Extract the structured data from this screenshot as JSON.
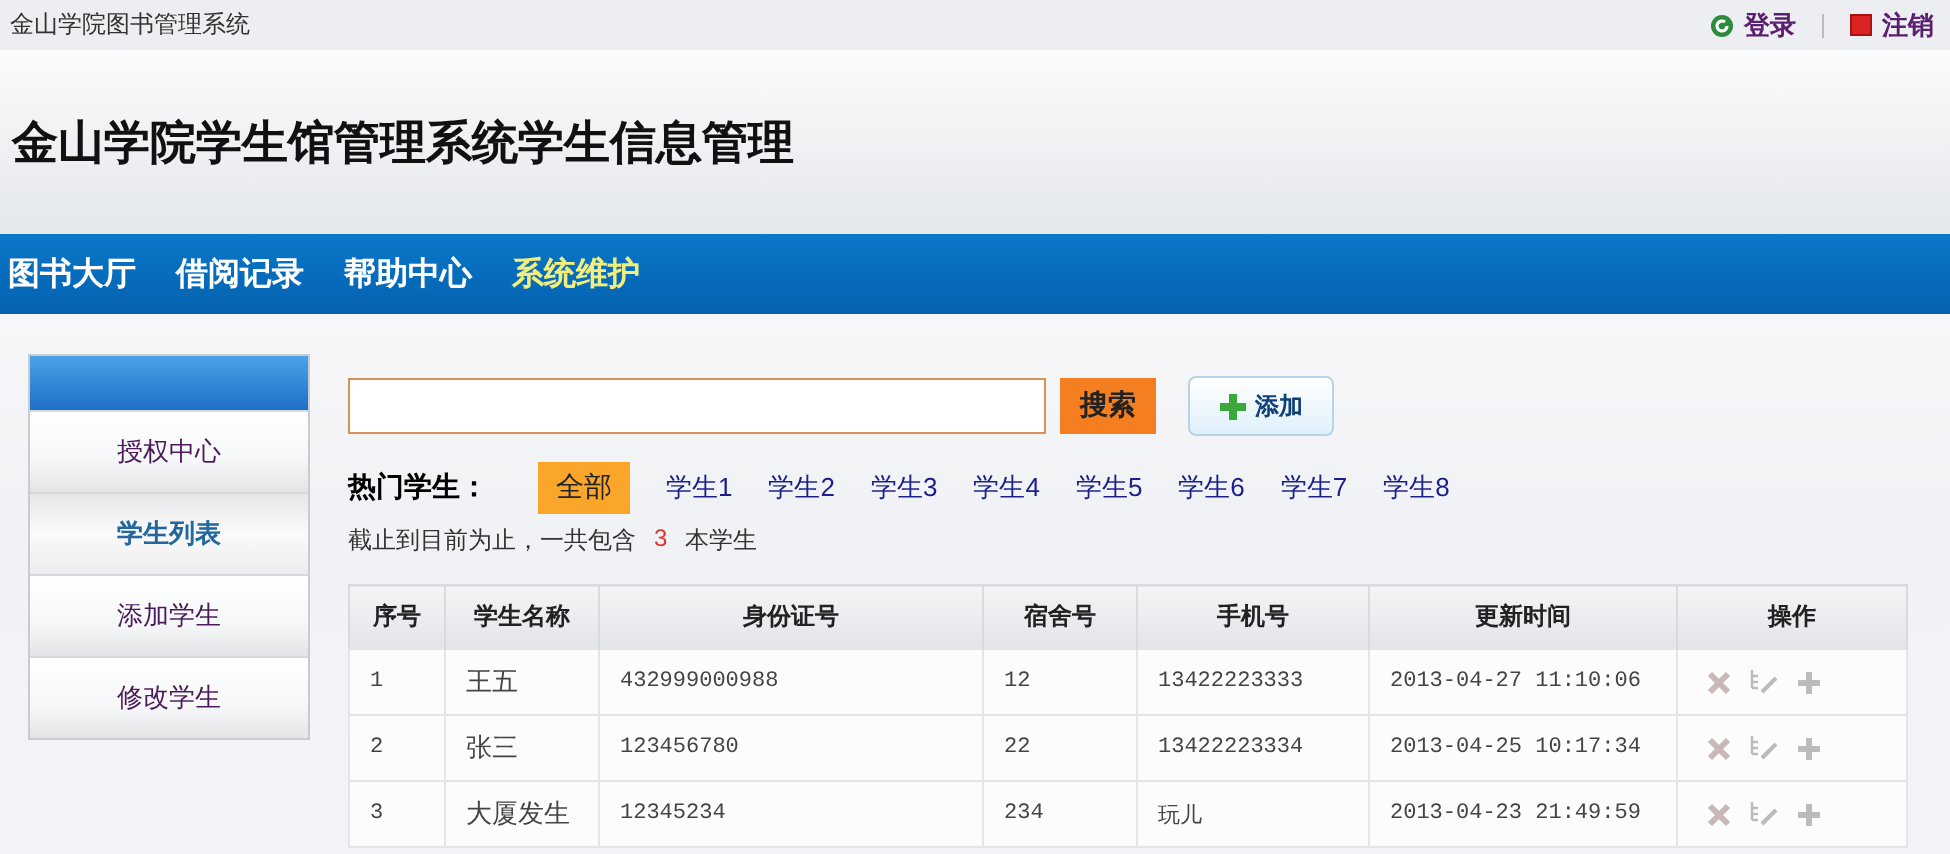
{
  "top_bar": {
    "title": "金山学院图书管理系统",
    "links": [
      {
        "kind": "login",
        "label": "登录"
      },
      {
        "kind": "logout",
        "label": "注销"
      }
    ]
  },
  "header": {
    "title": "金山学院学生馆管理系统学生信息管理"
  },
  "nav": [
    {
      "label": "图书大厅",
      "selected": false
    },
    {
      "label": "借阅记录",
      "selected": false
    },
    {
      "label": "帮助中心",
      "selected": false
    },
    {
      "label": "系统维护",
      "selected": true
    }
  ],
  "sidebar": {
    "items": [
      {
        "label": "授权中心",
        "selected": false
      },
      {
        "label": "学生列表",
        "selected": true
      },
      {
        "label": "添加学生",
        "selected": false
      },
      {
        "label": "修改学生",
        "selected": false
      }
    ]
  },
  "search": {
    "button": "搜索",
    "add_button": "添加"
  },
  "hot": {
    "label": "热门学生：",
    "tags": [
      {
        "label": "全部",
        "selected": true
      },
      {
        "label": "学生1",
        "selected": false
      },
      {
        "label": "学生2",
        "selected": false
      },
      {
        "label": "学生3",
        "selected": false
      },
      {
        "label": "学生4",
        "selected": false
      },
      {
        "label": "学生5",
        "selected": false
      },
      {
        "label": "学生6",
        "selected": false
      },
      {
        "label": "学生7",
        "selected": false
      },
      {
        "label": "学生8",
        "selected": false
      }
    ]
  },
  "summary": {
    "before": "截止到目前为止，一共包含",
    "count": "3",
    "after": "本学生"
  },
  "table": {
    "columns": [
      "序号",
      "学生名称",
      "身份证号",
      "宿舍号",
      "手机号",
      "更新时间",
      "操作"
    ],
    "rows": [
      [
        "1",
        "王五",
        "432999000988",
        "12",
        "13422223333",
        "2013-04-27 11:10:06"
      ],
      [
        "2",
        "张三",
        "123456780",
        "22",
        "13422223334",
        "2013-04-25 10:17:34"
      ],
      [
        "3",
        "大厦发生",
        "12345234",
        "234",
        "玩儿",
        "2013-04-23 21:49:59"
      ]
    ]
  }
}
